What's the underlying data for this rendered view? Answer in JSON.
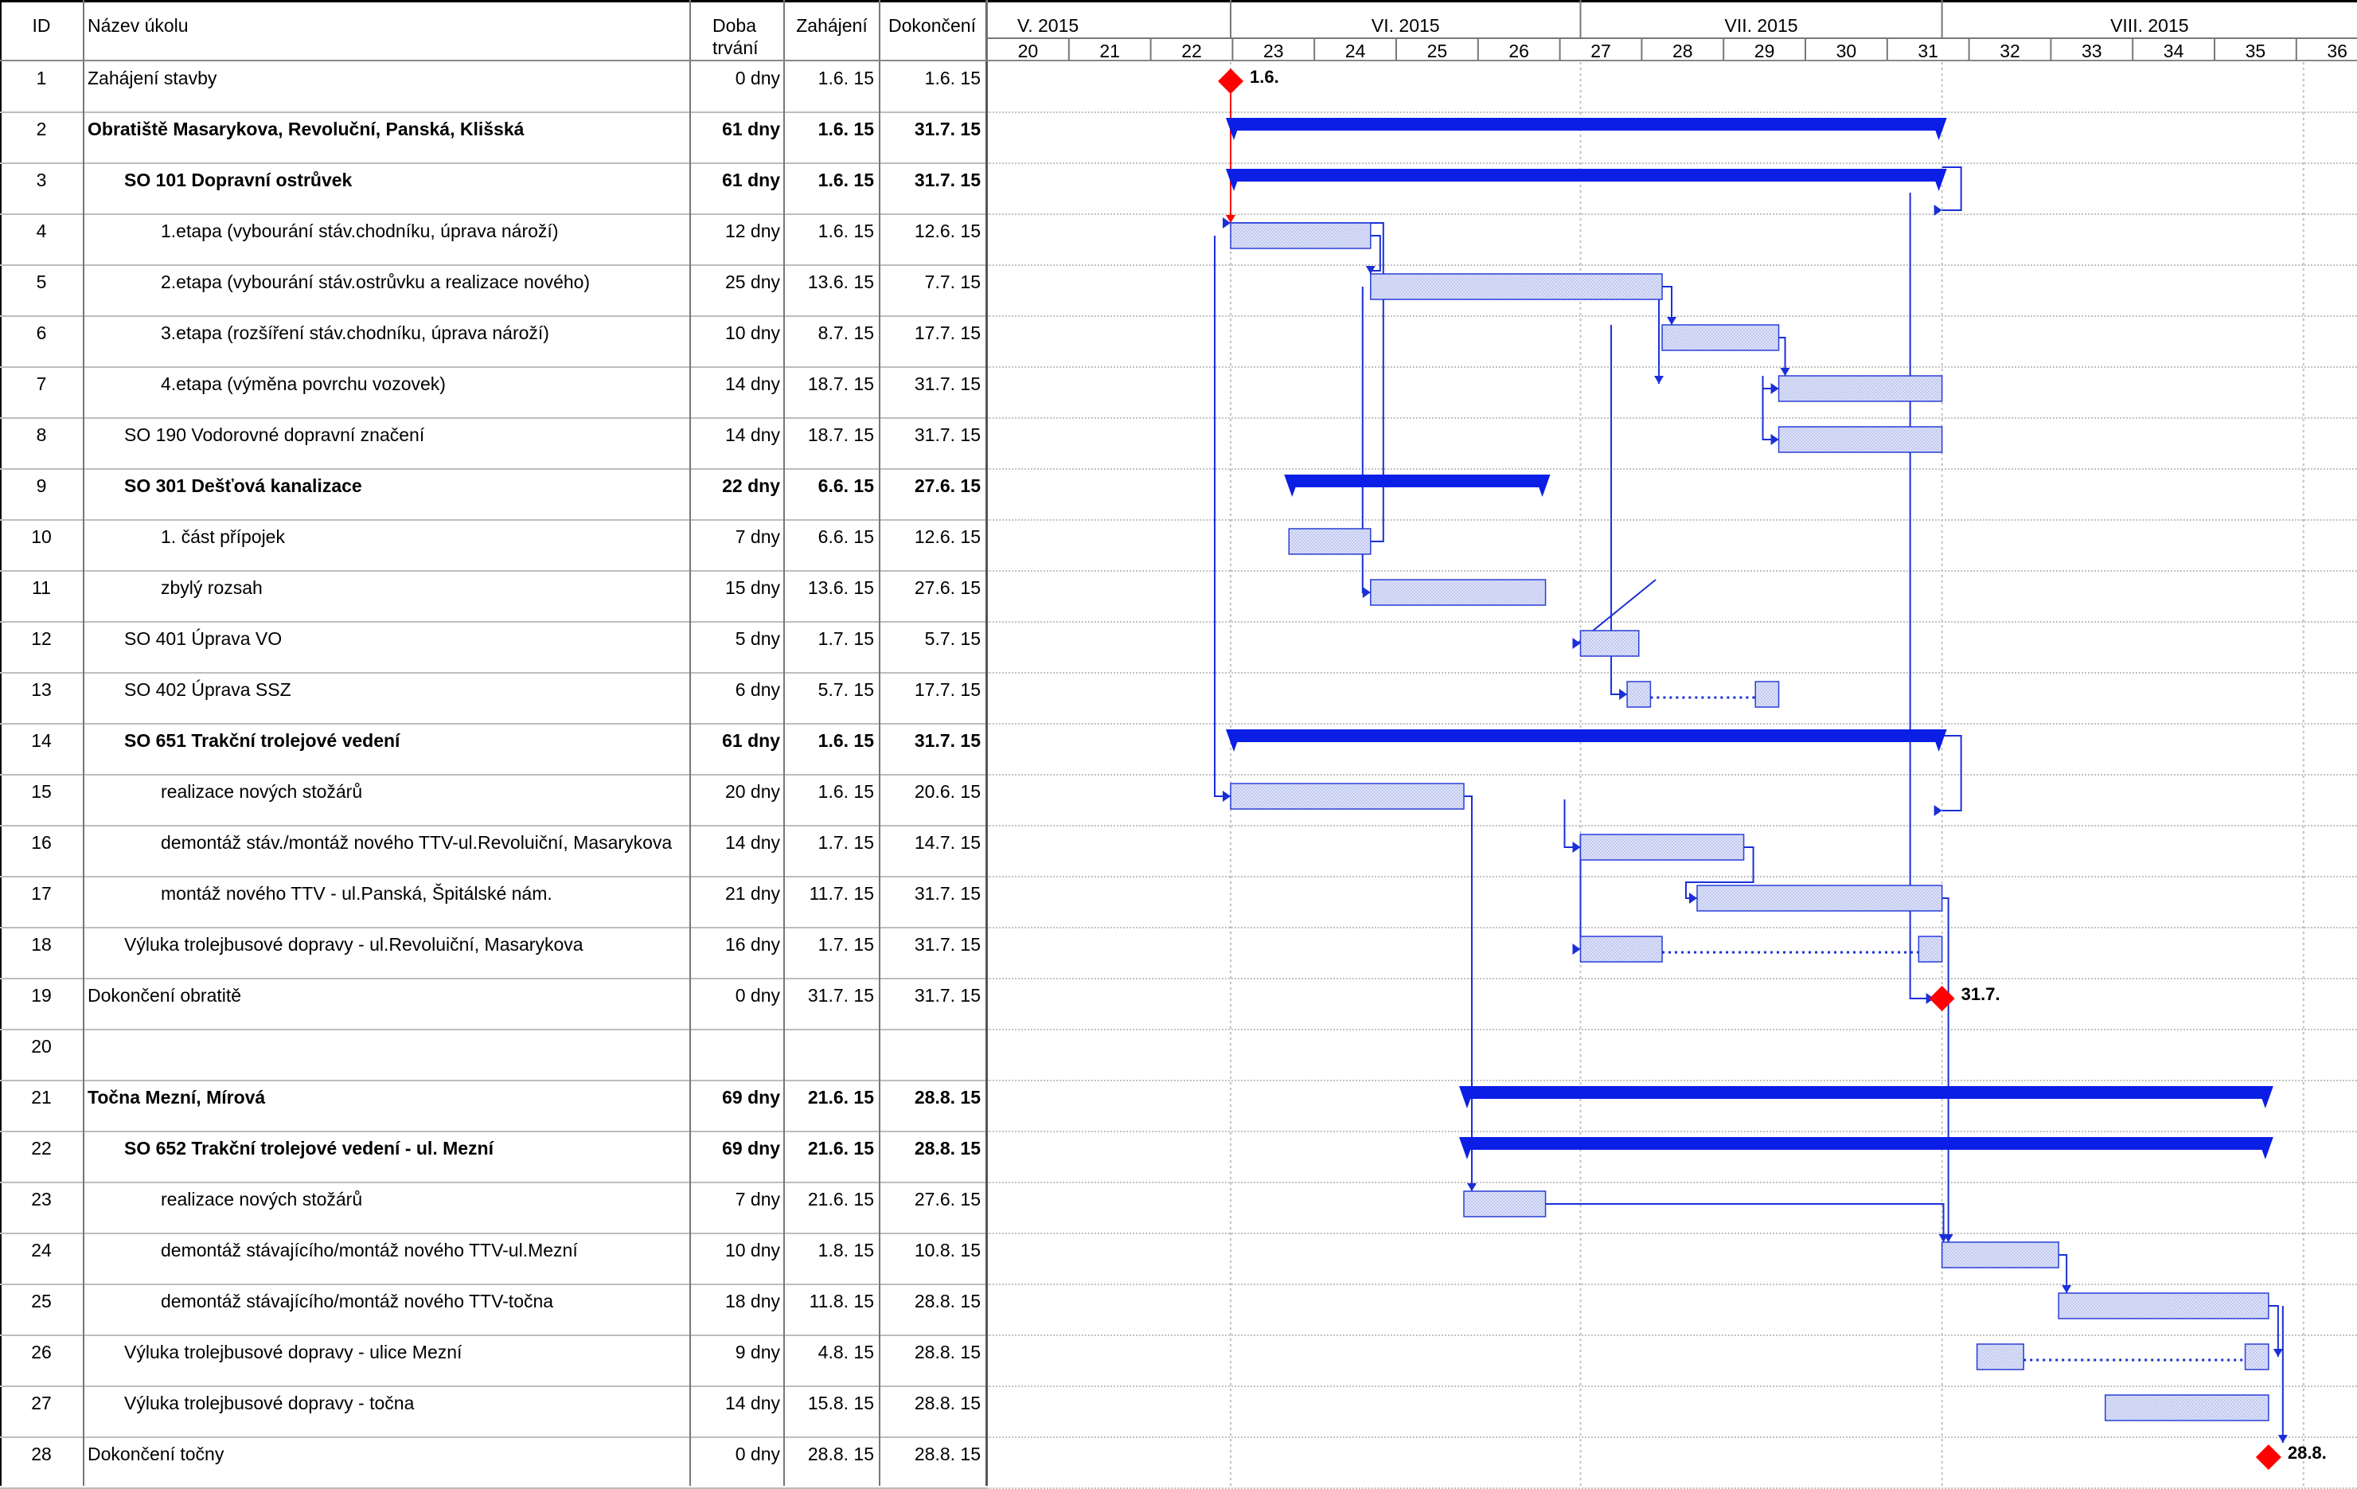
{
  "columns": {
    "id": "ID",
    "name": "Název úkolu",
    "duration_line1": "Doba",
    "duration_line2": "trvání",
    "start": "Zahájení",
    "finish": "Dokončení"
  },
  "timescale": {
    "months": [
      "V. 2015",
      "VI. 2015",
      "VII. 2015",
      "VIII. 2015"
    ],
    "weeks": [
      "20",
      "21",
      "22",
      "23",
      "24",
      "25",
      "26",
      "27",
      "28",
      "29",
      "30",
      "31",
      "32",
      "33",
      "34",
      "35",
      "36"
    ]
  },
  "colors": {
    "summary_bar": "#0a1ee6",
    "task_bar_fill": "#dde2f8",
    "task_bar_border": "#2b3fd9",
    "link_line": "#1a2fd8",
    "milestone": "#ff0000",
    "critical_link": "#ff0000"
  },
  "tasks": [
    {
      "id": "1",
      "name": "Zahájení stavby",
      "duration": "0 dny",
      "start": "1.6. 15",
      "finish": "1.6. 15",
      "level": 0,
      "summary": false,
      "milestone_label": "1.6."
    },
    {
      "id": "2",
      "name": "Obratiště Masarykova, Revoluční, Panská, Klišská",
      "duration": "61 dny",
      "start": "1.6. 15",
      "finish": "31.7. 15",
      "level": 0,
      "summary": true
    },
    {
      "id": "3",
      "name": "SO 101 Dopravní ostrůvek",
      "duration": "61 dny",
      "start": "1.6. 15",
      "finish": "31.7. 15",
      "level": 1,
      "summary": true
    },
    {
      "id": "4",
      "name": "1.etapa (vybourání stáv.chodníku, úprava nároží)",
      "duration": "12 dny",
      "start": "1.6. 15",
      "finish": "12.6. 15",
      "level": 2,
      "summary": false
    },
    {
      "id": "5",
      "name": "2.etapa (vybourání stáv.ostrůvku a realizace nového)",
      "duration": "25 dny",
      "start": "13.6. 15",
      "finish": "7.7. 15",
      "level": 2,
      "summary": false
    },
    {
      "id": "6",
      "name": "3.etapa (rozšíření stáv.chodníku, úprava nároží)",
      "duration": "10 dny",
      "start": "8.7. 15",
      "finish": "17.7. 15",
      "level": 2,
      "summary": false
    },
    {
      "id": "7",
      "name": "4.etapa (výměna povrchu vozovek)",
      "duration": "14 dny",
      "start": "18.7. 15",
      "finish": "31.7. 15",
      "level": 2,
      "summary": false
    },
    {
      "id": "8",
      "name": "SO 190 Vodorovné dopravní značení",
      "duration": "14 dny",
      "start": "18.7. 15",
      "finish": "31.7. 15",
      "level": 1,
      "summary": false
    },
    {
      "id": "9",
      "name": "SO 301 Dešťová kanalizace",
      "duration": "22 dny",
      "start": "6.6. 15",
      "finish": "27.6. 15",
      "level": 1,
      "summary": true
    },
    {
      "id": "10",
      "name": "1. část přípojek",
      "duration": "7 dny",
      "start": "6.6. 15",
      "finish": "12.6. 15",
      "level": 2,
      "summary": false
    },
    {
      "id": "11",
      "name": "zbylý rozsah",
      "duration": "15 dny",
      "start": "13.6. 15",
      "finish": "27.6. 15",
      "level": 2,
      "summary": false
    },
    {
      "id": "12",
      "name": "SO 401 Úprava VO",
      "duration": "5 dny",
      "start": "1.7. 15",
      "finish": "5.7. 15",
      "level": 1,
      "summary": false
    },
    {
      "id": "13",
      "name": "SO 402 Úprava SSZ",
      "duration": "6 dny",
      "start": "5.7. 15",
      "finish": "17.7. 15",
      "level": 1,
      "summary": false
    },
    {
      "id": "14",
      "name": "SO 651 Trakční trolejové vedení",
      "duration": "61 dny",
      "start": "1.6. 15",
      "finish": "31.7. 15",
      "level": 1,
      "summary": true
    },
    {
      "id": "15",
      "name": "realizace nových stožárů",
      "duration": "20 dny",
      "start": "1.6. 15",
      "finish": "20.6. 15",
      "level": 2,
      "summary": false
    },
    {
      "id": "16",
      "name": "demontáž stáv./montáž nového TTV-ul.Revoluiční, Masarykova",
      "duration": "14 dny",
      "start": "1.7. 15",
      "finish": "14.7. 15",
      "level": 2,
      "summary": false
    },
    {
      "id": "17",
      "name": "montáž nového TTV - ul.Panská, Špitálské nám.",
      "duration": "21 dny",
      "start": "11.7. 15",
      "finish": "31.7. 15",
      "level": 2,
      "summary": false
    },
    {
      "id": "18",
      "name": "Výluka trolejbusové dopravy - ul.Revoluiční, Masarykova",
      "duration": "16 dny",
      "start": "1.7. 15",
      "finish": "31.7. 15",
      "level": 1,
      "summary": false
    },
    {
      "id": "19",
      "name": "Dokončení obratitě",
      "duration": "0 dny",
      "start": "31.7. 15",
      "finish": "31.7. 15",
      "level": 0,
      "summary": false,
      "milestone_label": "31.7."
    },
    {
      "id": "20",
      "name": "",
      "duration": "",
      "start": "",
      "finish": "",
      "level": 0,
      "summary": false
    },
    {
      "id": "21",
      "name": "Točna Mezní, Mírová",
      "duration": "69 dny",
      "start": "21.6. 15",
      "finish": "28.8. 15",
      "level": 0,
      "summary": true
    },
    {
      "id": "22",
      "name": "SO 652 Trakční trolejové vedení - ul. Mezní",
      "duration": "69 dny",
      "start": "21.6. 15",
      "finish": "28.8. 15",
      "level": 1,
      "summary": true
    },
    {
      "id": "23",
      "name": "realizace nových stožárů",
      "duration": "7 dny",
      "start": "21.6. 15",
      "finish": "27.6. 15",
      "level": 2,
      "summary": false
    },
    {
      "id": "24",
      "name": "demontáž stávajícího/montáž nového TTV-ul.Mezní",
      "duration": "10 dny",
      "start": "1.8. 15",
      "finish": "10.8. 15",
      "level": 2,
      "summary": false
    },
    {
      "id": "25",
      "name": "demontáž stávajícího/montáž nového TTV-točna",
      "duration": "18 dny",
      "start": "11.8. 15",
      "finish": "28.8. 15",
      "level": 2,
      "summary": false
    },
    {
      "id": "26",
      "name": "Výluka trolejbusové dopravy - ulice Mezní",
      "duration": "9 dny",
      "start": "4.8. 15",
      "finish": "28.8. 15",
      "level": 1,
      "summary": false
    },
    {
      "id": "27",
      "name": "Výluka trolejbusové dopravy - točna",
      "duration": "14 dny",
      "start": "15.8. 15",
      "finish": "28.8. 15",
      "level": 1,
      "summary": false
    },
    {
      "id": "28",
      "name": "Dokončení točny",
      "duration": "0 dny",
      "start": "28.8. 15",
      "finish": "28.8. 15",
      "level": 0,
      "summary": false,
      "milestone_label": "28.8."
    }
  ]
}
